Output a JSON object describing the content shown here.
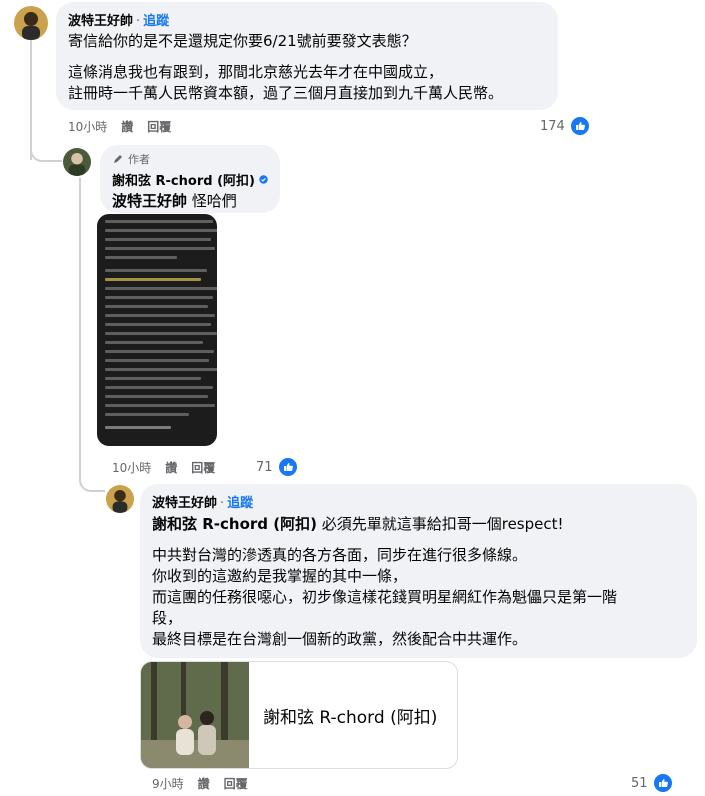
{
  "colors": {
    "link_blue": "#1877f2",
    "bubble_bg": "#f0f2f5",
    "meta_gray": "#65676b"
  },
  "comment1": {
    "author": "波特王好帥",
    "dot": "·",
    "follow": "追蹤",
    "p1": "寄信給你的是不是還規定你要6/21號前要發文表態？",
    "p2a": "這條消息我也有跟到，那間北京慈光去年才在中國成立，",
    "p2b": "註冊時一千萬人民幣資本額，過了三個月直接加到九千萬人民幣。",
    "time": "10小時",
    "reply": "讚",
    "reply2": "回覆",
    "likes": "174"
  },
  "comment2": {
    "author_badge": "作者",
    "author": "謝和弦 R-chord (阿扣)",
    "tag": "波特王好帥",
    "text": "怪哈們",
    "time": "10小時",
    "like": "讚",
    "reply": "回覆",
    "likes": "71"
  },
  "comment3": {
    "author": "波特王好帥",
    "dot": "·",
    "follow": "追蹤",
    "tag": "謝和弦 R-chord (阿扣)",
    "text1": "必須先單就這事給扣哥一個respect!",
    "p1": "中共對台灣的滲透真的各方各面，同步在進行很多條線。",
    "p2": "你收到的這邀約是我掌握的其中一條，",
    "p3a": "而這團的任務很噁心，初步像這樣花錢買明星網紅作為魁儡只是第一階",
    "p3b": "段，",
    "p4": "最終目標是在台灣創一個新的政黨，然後配合中共運作。",
    "link_title": "謝和弦 R-chord (阿扣)",
    "time": "9小時",
    "like": "讚",
    "reply": "回覆",
    "likes": "51"
  }
}
